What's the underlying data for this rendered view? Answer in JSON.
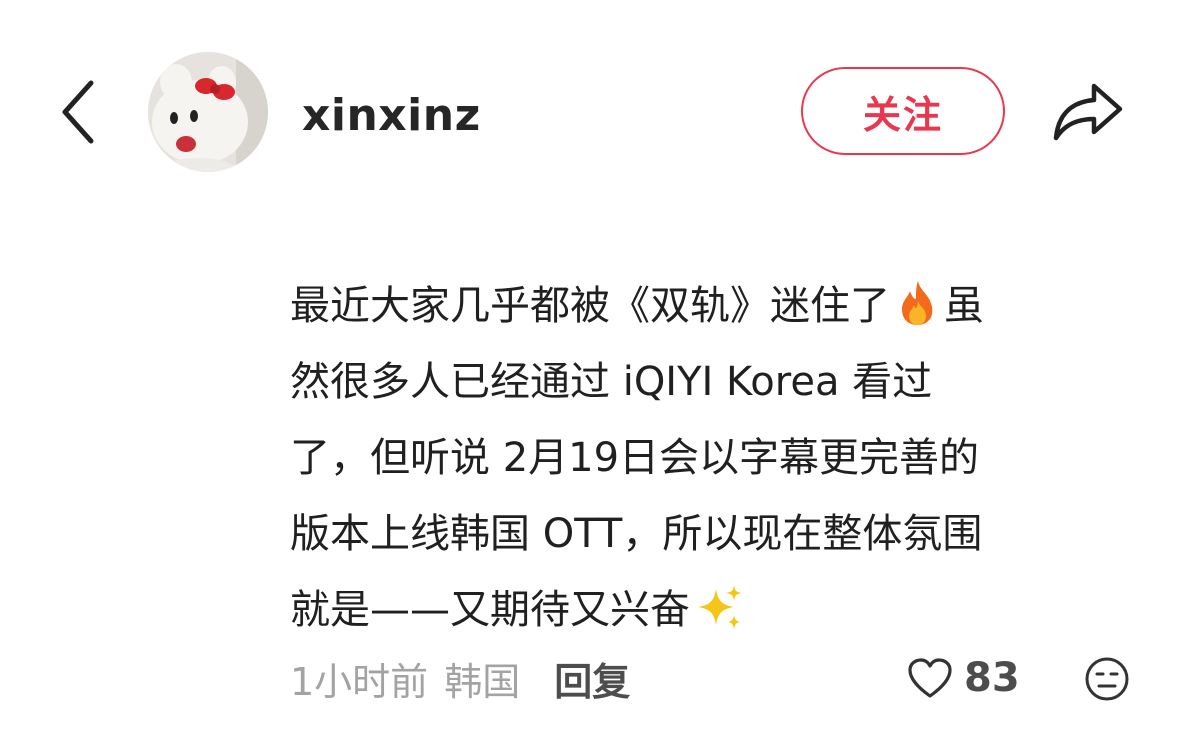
{
  "header": {
    "back_icon": "chevron-left-icon",
    "username": "xinxinz",
    "follow_label": "关注",
    "share_icon": "share-arrow-icon",
    "accent_color": "#e8384f"
  },
  "comment": {
    "lines": [
      "最近大家几乎都被《双轨》迷住了",
      "虽",
      "然很多人已经通过 iQIYI Korea 看过",
      "了，但听说 2月19日会以字幕更完善的",
      "版本上线韩国 OTT，所以现在整体氛围",
      "就是——又期待又兴奋"
    ],
    "emojis": [
      "fire-emoji",
      "sparkles-emoji"
    ]
  },
  "meta": {
    "time": "1小时前",
    "location": "韩国",
    "reply_label": "回复",
    "like_count": "83",
    "like_icon": "heart-outline-icon",
    "dislike_icon": "meh-face-icon"
  }
}
